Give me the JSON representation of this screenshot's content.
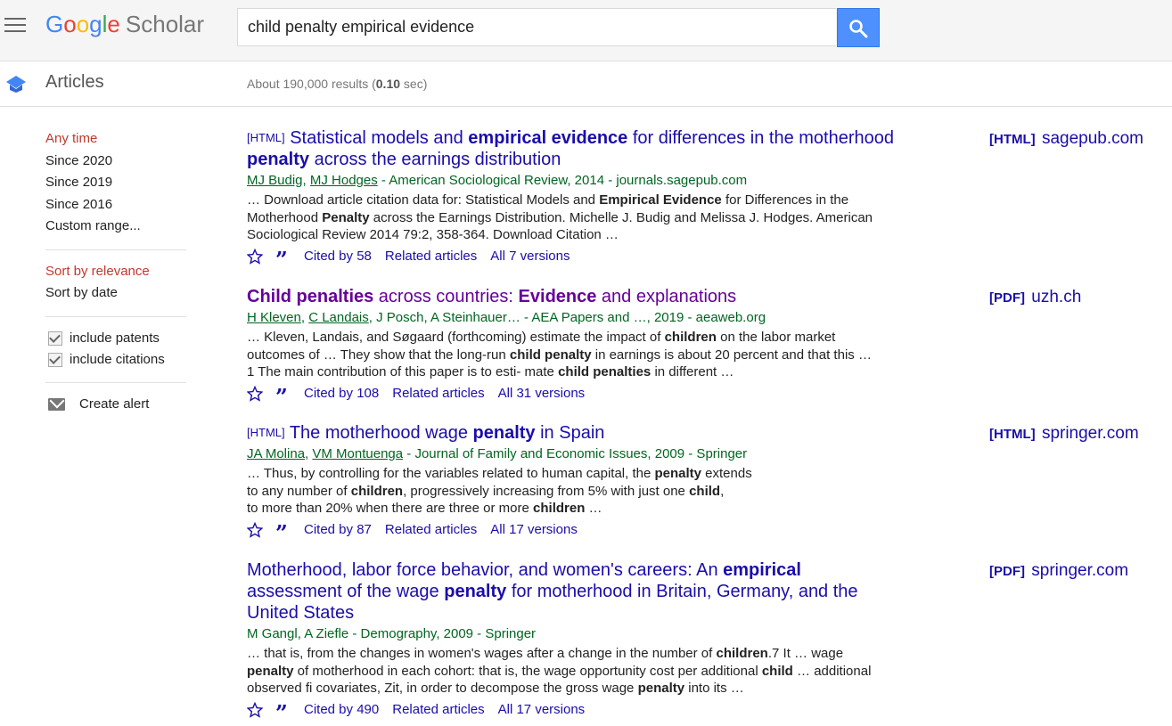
{
  "header": {
    "logo_google": [
      "G",
      "o",
      "o",
      "g",
      "l",
      "e"
    ],
    "logo_scholar": "Scholar",
    "search_value": "child penalty empirical evidence"
  },
  "subheader": {
    "articles_label": "Articles",
    "result_count_prefix": "About 190,000 results (",
    "result_count_time": "0.10",
    "result_count_suffix": " sec)"
  },
  "sidebar": {
    "time_filters": [
      "Any time",
      "Since 2020",
      "Since 2019",
      "Since 2016",
      "Custom range..."
    ],
    "sort": [
      "Sort by relevance",
      "Sort by date"
    ],
    "include_patents": "include patents",
    "include_citations": "include citations",
    "create_alert": "Create alert"
  },
  "results": [
    {
      "tag": "[HTML]",
      "title_html": "Statistical models and <b>empirical evidence</b> for differences in the motherhood <b>penalty</b> across the earnings distribution",
      "authors_html": "<span class=\"au\">MJ Budig</span>, <span class=\"au\">MJ Hodges</span> - American Sociological Review, 2014 - journals.sagepub.com",
      "snippet_html": "… Download article citation data for: Statistical Models and <b>Empirical Evidence</b> for Differences in the Motherhood <b>Penalty</b> across the Earnings Distribution. Michelle J. Budig and Melissa J. Hodges. American Sociological Review 2014 79:2, 358-364. Download Citation …",
      "cited_by": "Cited by 58",
      "related": "Related articles",
      "versions": "All 7 versions",
      "side_tag": "[HTML]",
      "side_domain": "sagepub.com"
    },
    {
      "tag": "",
      "title_html": "<b>Child penalties</b> across countries: <b>Evidence</b> and explanations",
      "authors_html": "<span class=\"au\">H Kleven</span>, <span class=\"au\">C Landais</span>, J Posch, A Steinhauer… - AEA Papers and …, 2019 - aeaweb.org",
      "snippet_html": "… Kleven, Landais, and Søgaard (forthcoming) estimate the impact of <b>children</b> on the labor market outcomes of … They show that the long-run <b>child penalty</b> in earnings is about 20 percent and that this … 1 The main contribution of this paper is to esti- mate <b>child penalties</b> in different …",
      "cited_by": "Cited by 108",
      "related": "Related articles",
      "versions": "All 31 versions",
      "side_tag": "[PDF]",
      "side_domain": "uzh.ch"
    },
    {
      "tag": "[HTML]",
      "title_html": "The motherhood wage <b>penalty</b> in Spain",
      "authors_html": "<span class=\"au\">JA Molina</span>, <span class=\"au\">VM Montuenga</span> - Journal of Family and Economic Issues, 2009 - Springer",
      "snippet_html": "… Thus, by controlling for the variables related to human capital, the <b>penalty</b> extends<br>to any number of <b>children</b>, progressively increasing from 5% with just one <b>child</b>,<br>to more than 20% when there are three or more <b>children</b> …",
      "cited_by": "Cited by 87",
      "related": "Related articles",
      "versions": "All 17 versions",
      "side_tag": "[HTML]",
      "side_domain": "springer.com"
    },
    {
      "tag": "",
      "title_html": "Motherhood, labor force behavior, and women's careers: An <b>empirical</b> assessment of the wage <b>penalty</b> for motherhood in Britain, Germany, and the United States",
      "authors_html": "M Gangl, A Ziefle - Demography, 2009 - Springer",
      "snippet_html": "… that is, from the changes in women's wages after a change in the number of <b>children</b>.7 It … wage <b>penalty</b> of motherhood in each cohort: that is, the wage opportunity cost per additional <b>child</b> … additional observed fi covariates, Zit, in order to decompose the gross wage <b>penalty</b> into its …",
      "cited_by": "Cited by 490",
      "related": "Related articles",
      "versions": "All 17 versions",
      "side_tag": "[PDF]",
      "side_domain": "springer.com"
    }
  ]
}
